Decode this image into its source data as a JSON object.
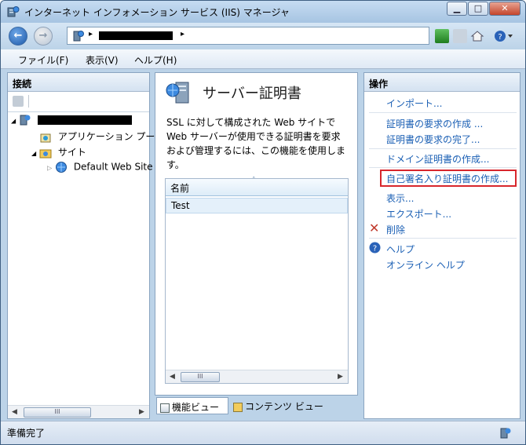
{
  "window": {
    "title": "インターネット インフォメーション サービス (IIS) マネージャ",
    "minimize_icon": "minimize-icon",
    "maximize_icon": "maximize-icon",
    "close_icon": "close-icon"
  },
  "address": {
    "separator": "▸",
    "server_name_redacted": ""
  },
  "menu": {
    "file": "ファイル(F)",
    "view": "表示(V)",
    "help": "ヘルプ(H)"
  },
  "connections": {
    "title": "接続",
    "tree": [
      {
        "label": "",
        "expander": "◢"
      },
      {
        "label": "アプリケーション プー"
      },
      {
        "label": "サイト",
        "expander": "◢"
      },
      {
        "label": "Default Web Site",
        "expander": "▷"
      }
    ]
  },
  "center": {
    "title": "サーバー証明書",
    "description": "SSL に対して構成された Web サイトで Web サーバーが使用できる証明書を要求および管理するには、この機能を使用します。",
    "column_name": "名前",
    "rows": [
      "Test"
    ],
    "sort_indicator": "˄"
  },
  "view_tabs": {
    "features": "機能ビュー",
    "content": "コンテンツ ビュー"
  },
  "actions": {
    "title": "操作",
    "items": [
      "インポート...",
      "証明書の要求の作成 ...",
      "証明書の要求の完了...",
      "ドメイン証明書の作成...",
      "自己署名入り証明書の作成...",
      "表示...",
      "エクスポート...",
      "削除",
      "ヘルプ",
      "オンライン ヘルプ"
    ]
  },
  "status": {
    "text": "準備完了"
  },
  "scroll": {
    "left": "◀",
    "right": "▶",
    "grip": "III"
  },
  "colors": {
    "link": "#1a5fb4",
    "highlight_border": "#d8262c",
    "delete_x": "#c0392b",
    "help_circle": "#2a62b8"
  }
}
